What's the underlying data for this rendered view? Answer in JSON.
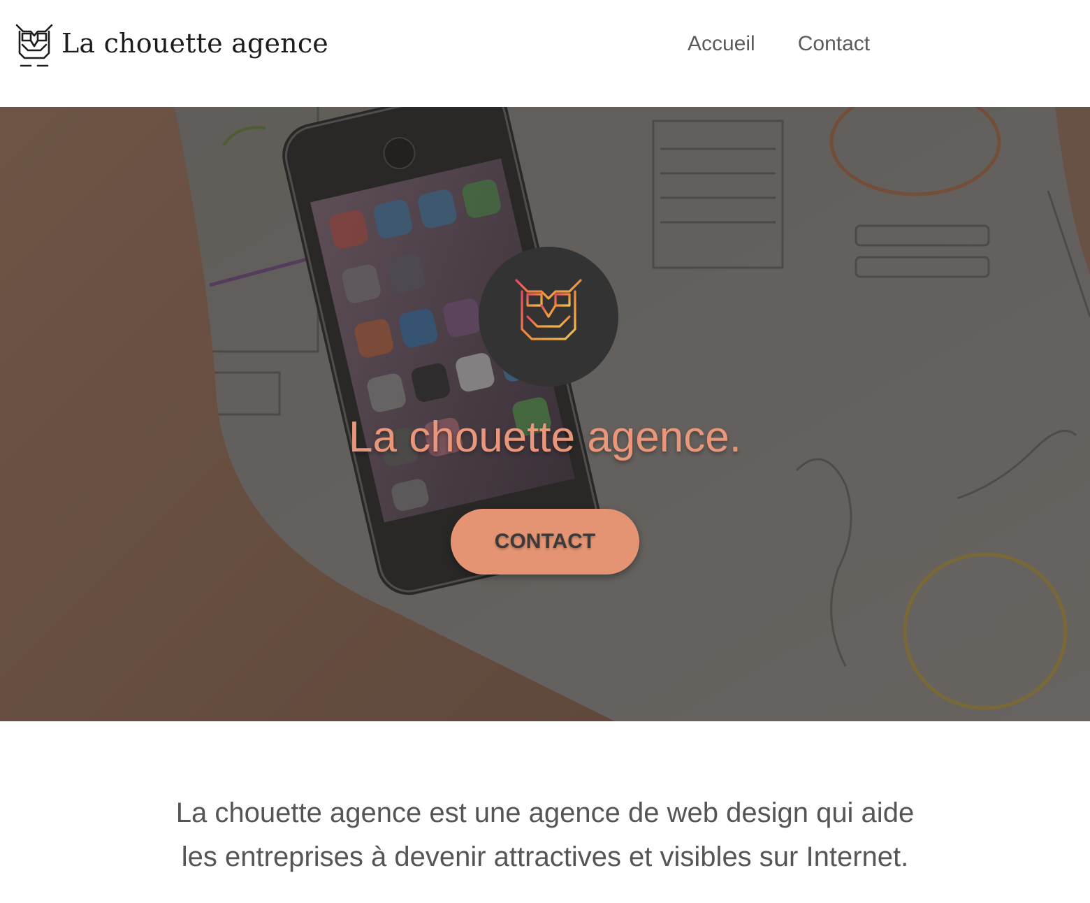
{
  "brand": {
    "name": "La chouette agence",
    "logo_icon": "owl-icon"
  },
  "nav": {
    "items": [
      {
        "label": "Accueil"
      },
      {
        "label": "Contact"
      }
    ]
  },
  "hero": {
    "badge_icon": "owl-icon",
    "title": "La chouette agence.",
    "cta_label": "CONTACT",
    "background": "photo-hand-holding-phone-over-wireframe-sketches"
  },
  "intro": {
    "line1": "La chouette agence est une agence de web design qui aide",
    "line2": "les entreprises à devenir attractives et visibles sur Internet."
  },
  "colors": {
    "accent": "#e9967a",
    "button": "#e59473",
    "text": "#555555",
    "badge": "#333333"
  }
}
